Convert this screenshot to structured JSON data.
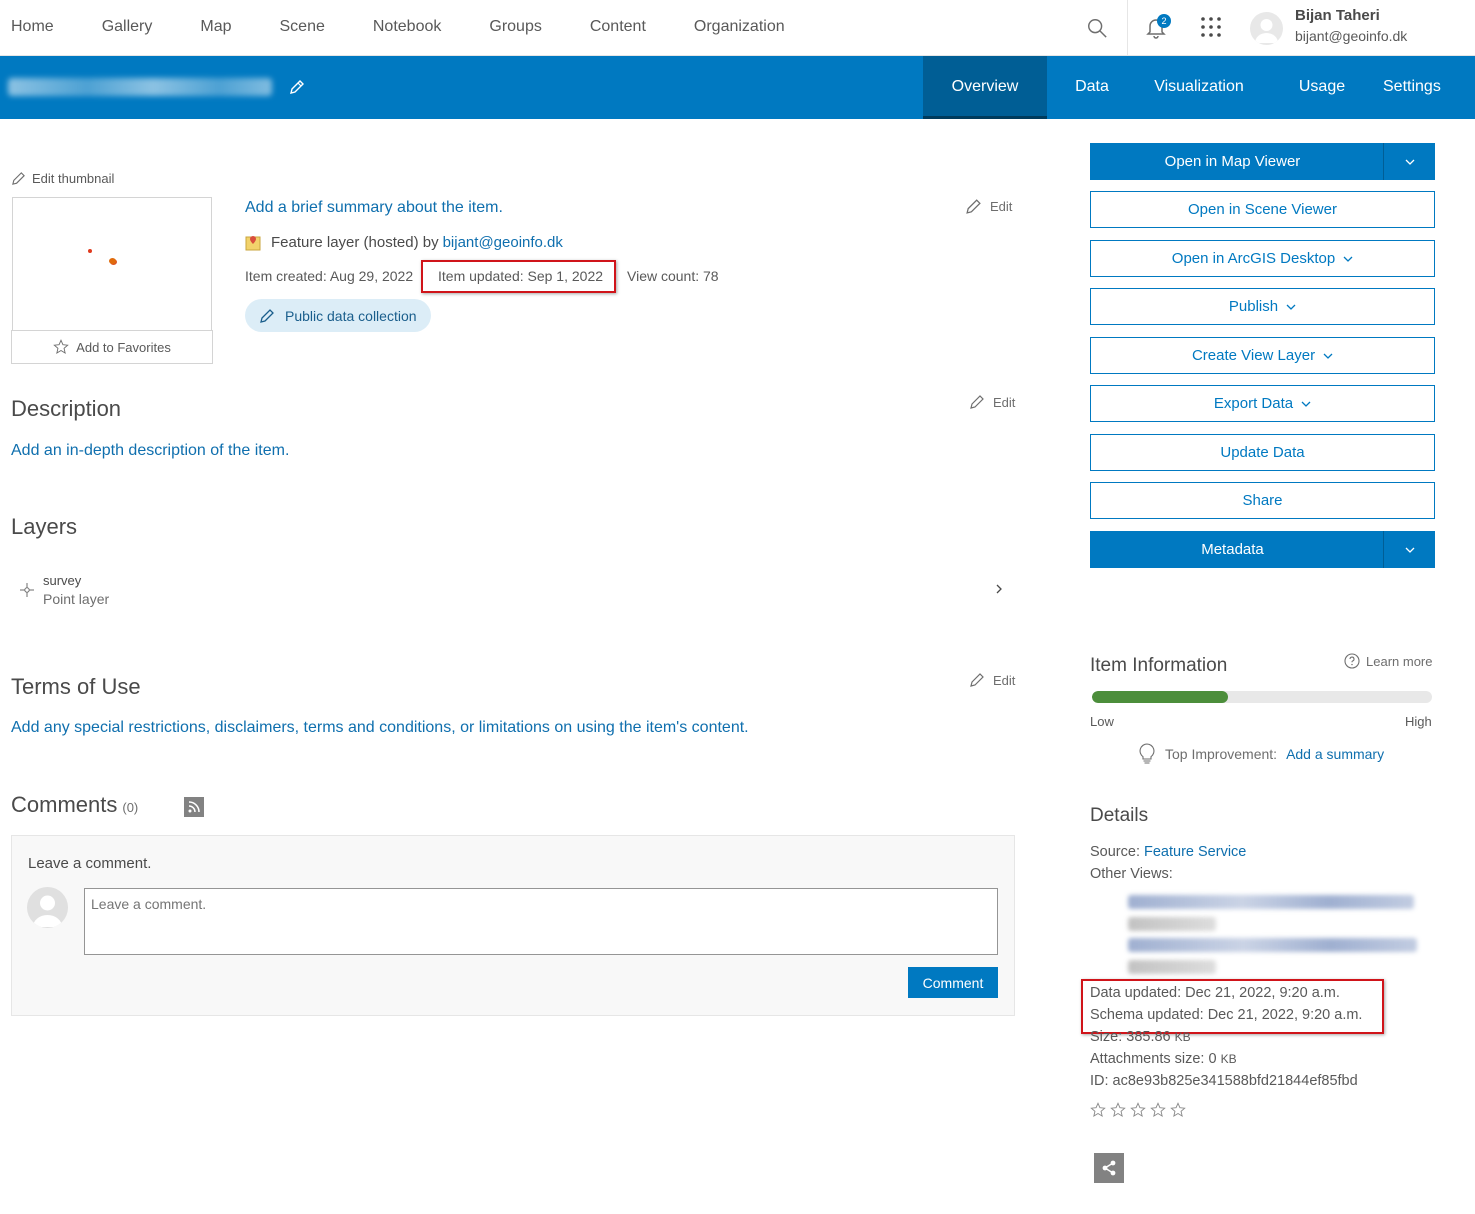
{
  "nav": {
    "links": [
      "Home",
      "Gallery",
      "Map",
      "Scene",
      "Notebook",
      "Groups",
      "Content",
      "Organization"
    ],
    "notification_count": "2",
    "user_name": "Bijan Taheri",
    "user_email": "bijant@geoinfo.dk"
  },
  "header": {
    "tabs": [
      "Overview",
      "Data",
      "Visualization",
      "Usage",
      "Settings"
    ],
    "active_tab": "Overview"
  },
  "overview": {
    "edit_thumbnail": "Edit thumbnail",
    "add_favorites": "Add to Favorites",
    "summary_link": "Add a brief summary about the item.",
    "edit_label": "Edit",
    "item_type": "Feature layer (hosted) by",
    "owner": "bijant@geoinfo.dk",
    "created": "Item created: Aug 29, 2022",
    "updated": "Item updated: Sep 1, 2022",
    "view_count": "View count: 78",
    "category_chip": "Public data collection"
  },
  "description": {
    "title": "Description",
    "link": "Add an in-depth description of the item."
  },
  "layers": {
    "title": "Layers",
    "items": [
      {
        "name": "survey",
        "type": "Point layer"
      }
    ]
  },
  "terms": {
    "title": "Terms of Use",
    "link": "Add any special restrictions, disclaimers, terms and conditions, or limitations on using the item's content."
  },
  "comments": {
    "title": "Comments",
    "count": "(0)",
    "label": "Leave a comment.",
    "placeholder": "Leave a comment.",
    "button": "Comment"
  },
  "actions": {
    "open_map_viewer": "Open in Map Viewer",
    "open_scene_viewer": "Open in Scene Viewer",
    "open_arcgis_desktop": "Open in ArcGIS Desktop",
    "publish": "Publish",
    "create_view_layer": "Create View Layer",
    "export_data": "Export Data",
    "update_data": "Update Data",
    "share": "Share",
    "metadata": "Metadata"
  },
  "item_info": {
    "title": "Item Information",
    "learn_more": "Learn more",
    "score_fraction": 0.4,
    "low": "Low",
    "high": "High",
    "top_improvement_label": "Top Improvement:",
    "top_improvement_link": "Add a summary"
  },
  "details": {
    "title": "Details",
    "source_label": "Source:",
    "source_value": "Feature Service",
    "other_views": "Other Views:",
    "data_updated": "Data updated: Dec 21, 2022, 9:20 a.m.",
    "schema_updated": "Schema updated: Dec 21, 2022, 9:20 a.m.",
    "size": "Size: 385.86",
    "size_unit": "KB",
    "attachments": "Attachments size: 0",
    "attachments_unit": "KB",
    "id": "ID: ac8e93b825e341588bfd21844ef85fbd"
  },
  "colors": {
    "accent": "#0079c1",
    "highlight_box": "#d0141a",
    "meter_fill": "#4c8e3b"
  }
}
